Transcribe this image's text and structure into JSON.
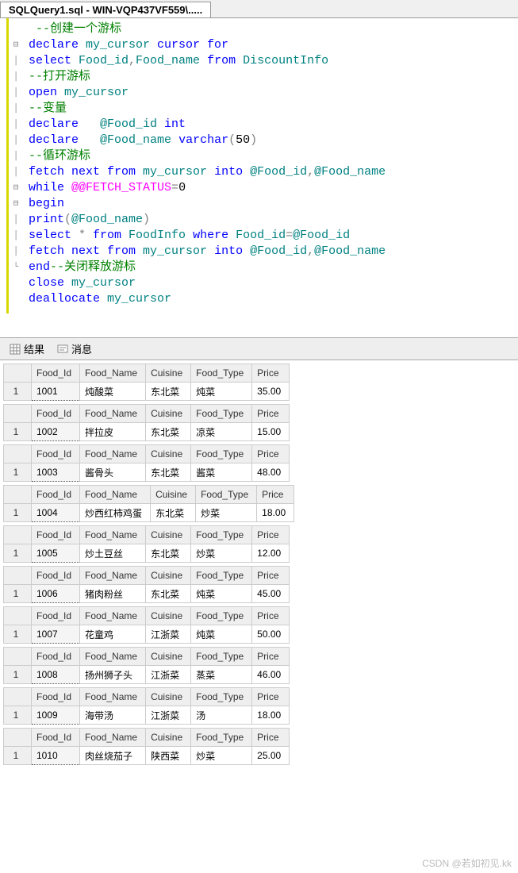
{
  "tab": {
    "title": "SQLQuery1.sql - WIN-VQP437VF559\\....."
  },
  "code": [
    {
      "g": " ",
      "frag": [
        {
          "cls": "c-comment",
          "t": "  --创建一个游标"
        }
      ]
    },
    {
      "g": "⊟",
      "frag": [
        {
          "cls": "c-keyword",
          "t": " declare"
        },
        {
          "cls": "c-ident",
          "t": " my_cursor "
        },
        {
          "cls": "c-keyword",
          "t": "cursor for"
        }
      ]
    },
    {
      "g": "│",
      "frag": [
        {
          "cls": "c-keyword",
          "t": " select"
        },
        {
          "cls": "c-ident",
          "t": " Food_id"
        },
        {
          "cls": "c-op",
          "t": ","
        },
        {
          "cls": "c-ident",
          "t": "Food_name "
        },
        {
          "cls": "c-keyword",
          "t": "from"
        },
        {
          "cls": "c-ident",
          "t": " DiscountInfo"
        }
      ]
    },
    {
      "g": "│",
      "frag": [
        {
          "cls": "c-comment",
          "t": " --打开游标"
        }
      ]
    },
    {
      "g": "│",
      "frag": [
        {
          "cls": "c-keyword",
          "t": " open"
        },
        {
          "cls": "c-ident",
          "t": " my_cursor"
        }
      ]
    },
    {
      "g": "│",
      "frag": [
        {
          "cls": "c-comment",
          "t": " --变量"
        }
      ]
    },
    {
      "g": "│",
      "frag": [
        {
          "cls": "c-keyword",
          "t": " declare   "
        },
        {
          "cls": "c-ident",
          "t": "@Food_id "
        },
        {
          "cls": "c-keyword",
          "t": "int"
        }
      ]
    },
    {
      "g": "│",
      "frag": [
        {
          "cls": "c-keyword",
          "t": " declare   "
        },
        {
          "cls": "c-ident",
          "t": "@Food_name "
        },
        {
          "cls": "c-keyword",
          "t": "varchar"
        },
        {
          "cls": "c-op",
          "t": "("
        },
        {
          "cls": "c-black",
          "t": "50"
        },
        {
          "cls": "c-op",
          "t": ")"
        }
      ]
    },
    {
      "g": "│",
      "frag": [
        {
          "cls": "c-comment",
          "t": " --循环游标"
        }
      ]
    },
    {
      "g": "│",
      "frag": [
        {
          "cls": "c-keyword",
          "t": " fetch next from"
        },
        {
          "cls": "c-ident",
          "t": " my_cursor "
        },
        {
          "cls": "c-keyword",
          "t": "into"
        },
        {
          "cls": "c-ident",
          "t": " @Food_id"
        },
        {
          "cls": "c-op",
          "t": ","
        },
        {
          "cls": "c-ident",
          "t": "@Food_name"
        }
      ]
    },
    {
      "g": "⊟",
      "frag": [
        {
          "cls": "c-keyword",
          "t": " while "
        },
        {
          "cls": "c-func",
          "t": "@@FETCH_STATUS"
        },
        {
          "cls": "c-op",
          "t": "="
        },
        {
          "cls": "c-black",
          "t": "0"
        }
      ]
    },
    {
      "g": "⊟",
      "frag": [
        {
          "cls": "c-keyword",
          "t": " begin"
        }
      ]
    },
    {
      "g": "│",
      "frag": [
        {
          "cls": "c-keyword",
          "t": " print"
        },
        {
          "cls": "c-op",
          "t": "("
        },
        {
          "cls": "c-ident",
          "t": "@Food_name"
        },
        {
          "cls": "c-op",
          "t": ")"
        }
      ]
    },
    {
      "g": "│",
      "frag": [
        {
          "cls": "c-keyword",
          "t": " select"
        },
        {
          "cls": "c-op",
          "t": " * "
        },
        {
          "cls": "c-keyword",
          "t": "from"
        },
        {
          "cls": "c-ident",
          "t": " FoodInfo "
        },
        {
          "cls": "c-keyword",
          "t": "where"
        },
        {
          "cls": "c-ident",
          "t": " Food_id"
        },
        {
          "cls": "c-op",
          "t": "="
        },
        {
          "cls": "c-ident",
          "t": "@Food_id"
        }
      ]
    },
    {
      "g": "│",
      "frag": [
        {
          "cls": "c-keyword",
          "t": " fetch next from"
        },
        {
          "cls": "c-ident",
          "t": " my_cursor "
        },
        {
          "cls": "c-keyword",
          "t": "into"
        },
        {
          "cls": "c-ident",
          "t": " @Food_id"
        },
        {
          "cls": "c-op",
          "t": ","
        },
        {
          "cls": "c-ident",
          "t": "@Food_name"
        }
      ]
    },
    {
      "g": "└",
      "frag": [
        {
          "cls": "c-keyword",
          "t": " end"
        },
        {
          "cls": "c-comment",
          "t": "--关闭释放游标"
        }
      ]
    },
    {
      "g": " ",
      "frag": [
        {
          "cls": "c-keyword",
          "t": " close"
        },
        {
          "cls": "c-ident",
          "t": " my_cursor"
        }
      ]
    },
    {
      "g": " ",
      "frag": [
        {
          "cls": "c-keyword",
          "t": " deallocate"
        },
        {
          "cls": "c-ident",
          "t": " my_cursor"
        }
      ]
    }
  ],
  "result_tabs": {
    "results": "结果",
    "messages": "消息"
  },
  "columns": [
    "Food_Id",
    "Food_Name",
    "Cuisine",
    "Food_Type",
    "Price"
  ],
  "rows": [
    {
      "Food_Id": "1001",
      "Food_Name": "炖酸菜",
      "Cuisine": "东北菜",
      "Food_Type": "炖菜",
      "Price": "35.00"
    },
    {
      "Food_Id": "1002",
      "Food_Name": "拌拉皮",
      "Cuisine": "东北菜",
      "Food_Type": "凉菜",
      "Price": "15.00"
    },
    {
      "Food_Id": "1003",
      "Food_Name": "酱骨头",
      "Cuisine": "东北菜",
      "Food_Type": "酱菜",
      "Price": "48.00"
    },
    {
      "Food_Id": "1004",
      "Food_Name": "炒西红柿鸡蛋",
      "Cuisine": "东北菜",
      "Food_Type": "炒菜",
      "Price": "18.00"
    },
    {
      "Food_Id": "1005",
      "Food_Name": "炒土豆丝",
      "Cuisine": "东北菜",
      "Food_Type": "炒菜",
      "Price": "12.00"
    },
    {
      "Food_Id": "1006",
      "Food_Name": "猪肉粉丝",
      "Cuisine": "东北菜",
      "Food_Type": "炖菜",
      "Price": "45.00"
    },
    {
      "Food_Id": "1007",
      "Food_Name": "花童鸡",
      "Cuisine": "江浙菜",
      "Food_Type": "炖菜",
      "Price": "50.00"
    },
    {
      "Food_Id": "1008",
      "Food_Name": "扬州狮子头",
      "Cuisine": "江浙菜",
      "Food_Type": "蒸菜",
      "Price": "46.00"
    },
    {
      "Food_Id": "1009",
      "Food_Name": "海带汤",
      "Cuisine": "江浙菜",
      "Food_Type": "汤",
      "Price": "18.00"
    },
    {
      "Food_Id": "1010",
      "Food_Name": "肉丝烧茄子",
      "Cuisine": "陕西菜",
      "Food_Type": "炒菜",
      "Price": "25.00"
    }
  ],
  "watermark": "CSDN @若如初见.kk"
}
